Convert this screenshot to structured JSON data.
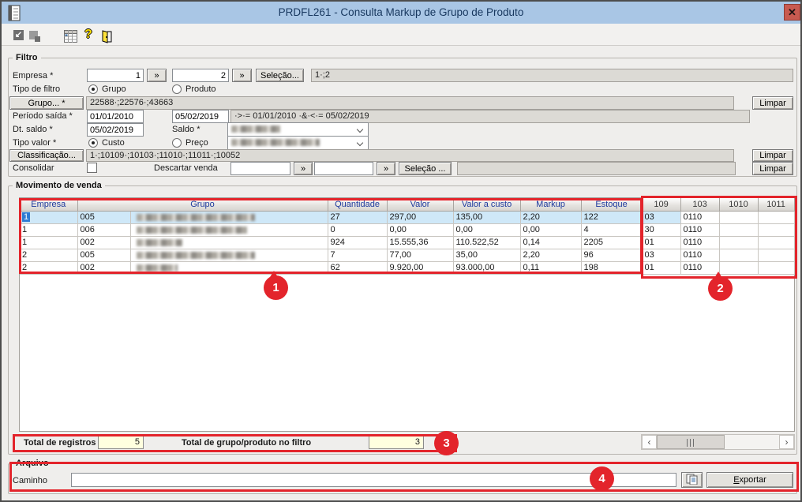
{
  "window": {
    "title": "PRDFL261 - Consulta Markup de Grupo de Produto",
    "close_glyph": "✕"
  },
  "toolbar": {
    "attach_glyph": "↙",
    "help_glyph": "?",
    "icon_names": [
      "attach",
      "cascade-windows",
      "grid",
      "help",
      "exit-door"
    ]
  },
  "filter": {
    "legend": "Filtro",
    "empresa_label": "Empresa *",
    "empresa_from": "1",
    "empresa_to": "2",
    "expand_glyph": "»",
    "selecao_btn": "Seleção...",
    "empresa_selected": "1·;2",
    "tipo_filtro_label": "Tipo de filtro",
    "opt_grupo": "Grupo",
    "opt_produto": "Produto",
    "grupo_btn": "Grupo... *",
    "grupo_value": "22588·;22576·;43663",
    "limpar_btn": "Limpar",
    "periodo_label": "Período saída *",
    "periodo_from": "01/01/2010",
    "periodo_to": "05/02/2019",
    "periodo_display": "·>·= 01/01/2010 ·&·<·= 05/02/2019",
    "dt_saldo_label": "Dt. saldo *",
    "dt_saldo_value": "05/02/2019",
    "saldo_label": "Saldo *",
    "saldo_redact_style": "width:62px",
    "tipo_valor_label": "Tipo valor *",
    "opt_custo": "Custo",
    "opt_preco": "Preço",
    "valor_combo_redact_style": "width:112px",
    "classificacao_btn": "Classificação...",
    "classificacao_value": "1·;10109·;10103·;11010·;11011·;10052",
    "consolidar_label": "Consolidar",
    "descartar_label": "Descartar venda",
    "selecao2_btn": "Seleção ..."
  },
  "grid": {
    "legend": "Movimento de venda",
    "headers": {
      "empresa": "Empresa",
      "grupo": "Grupo",
      "quantidade": "Quantidade",
      "valor": "Valor",
      "valor_custo": "Valor a custo",
      "markup": "Markup",
      "estoque": "Estoque",
      "c109": "109",
      "c103": "103",
      "c1010": "1010",
      "c1011": "1011"
    },
    "rows": [
      {
        "e": "1",
        "cod": "005",
        "redact_style": "width:150px",
        "qtd": "27",
        "val": "297,00",
        "custo": "135,00",
        "mkp": "2,20",
        "est": "122",
        "c109": "03",
        "c103": "0110",
        "c1010": "",
        "c1011": ""
      },
      {
        "e": "1",
        "cod": "006",
        "redact_style": "width:140px",
        "qtd": "0",
        "val": "0,00",
        "custo": "0,00",
        "mkp": "0,00",
        "est": "4",
        "c109": "30",
        "c103": "0110",
        "c1010": "",
        "c1011": ""
      },
      {
        "e": "1",
        "cod": "002",
        "redact_style": "width:58px",
        "qtd": "924",
        "val": "15.555,36",
        "custo": "110.522,52",
        "mkp": "0,14",
        "est": "2205",
        "c109": "01",
        "c103": "0110",
        "c1010": "",
        "c1011": ""
      },
      {
        "e": "2",
        "cod": "005",
        "redact_style": "width:150px",
        "qtd": "7",
        "val": "77,00",
        "custo": "35,00",
        "mkp": "2,20",
        "est": "96",
        "c109": "03",
        "c103": "0110",
        "c1010": "",
        "c1011": ""
      },
      {
        "e": "2",
        "cod": "002",
        "redact_style": "width:52px",
        "qtd": "62",
        "val": "9.920,00",
        "custo": "93.000,00",
        "mkp": "0,11",
        "est": "198",
        "c109": "01",
        "c103": "0110",
        "c1010": "",
        "c1011": ""
      }
    ],
    "totals": {
      "registros_label": "Total de registros",
      "registros_value": "5",
      "grupos_label": "Total de grupo/produto no filtro",
      "grupos_value": "3"
    },
    "scrollbar": {
      "left": "‹",
      "right": "›"
    }
  },
  "arquivo": {
    "legend": "Arquivo",
    "caminho_label": "Caminho",
    "caminho_value": "",
    "exportar_btn": "Exportar"
  },
  "annotations": {
    "n1": "1",
    "n2": "2",
    "n3": "3",
    "n4": "4"
  },
  "colors": {
    "annotation_red": "#e3242b",
    "titlebar_blue": "#a9c6e5",
    "selected_row": "#cfe8f8",
    "header_text_blue": "#1e3a9e",
    "close_red": "#c85a50"
  }
}
